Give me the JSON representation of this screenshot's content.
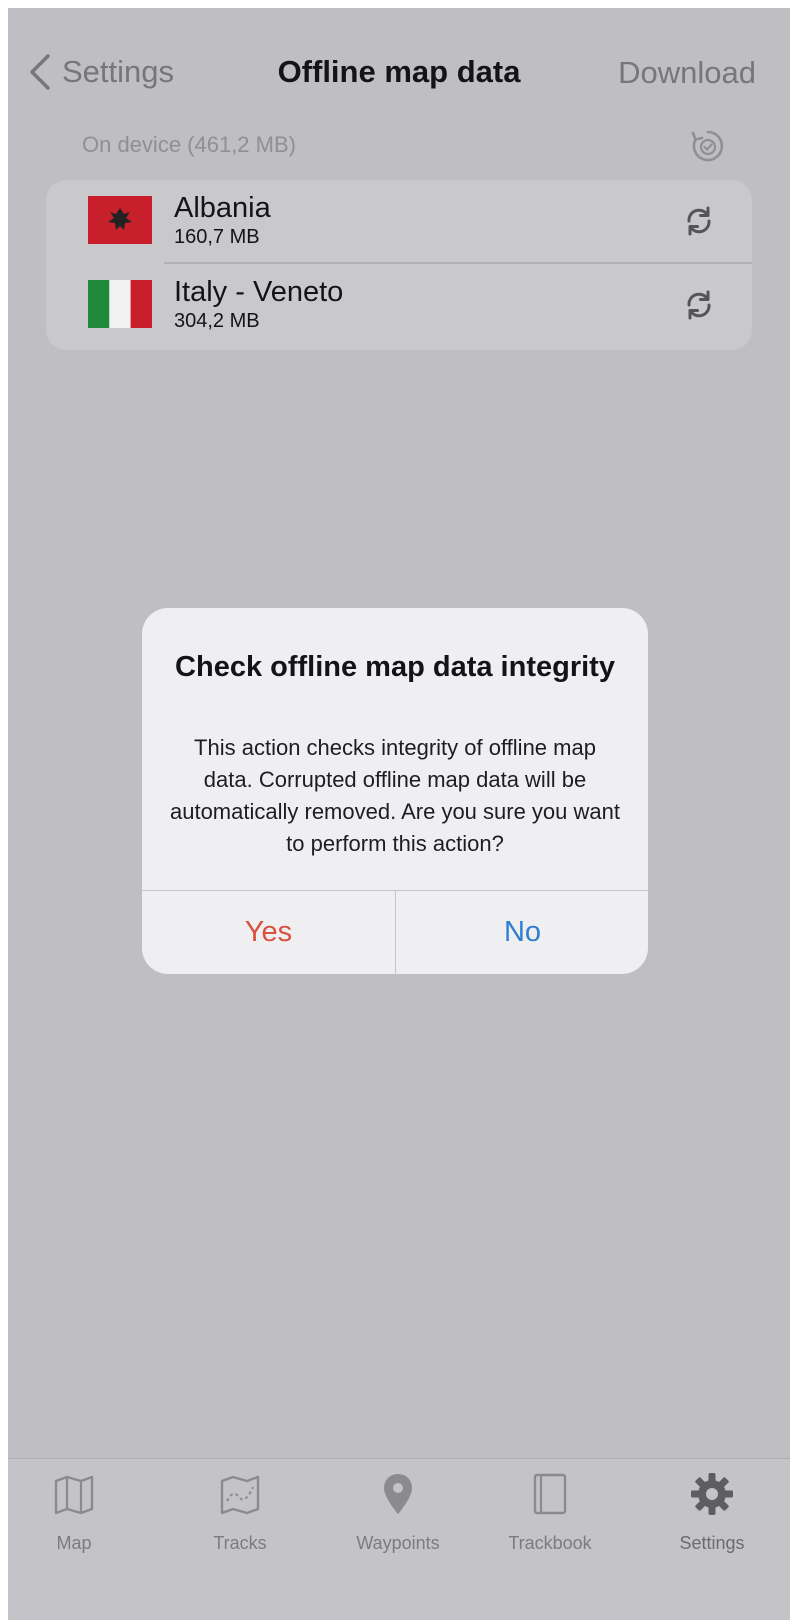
{
  "nav": {
    "back_label": "Settings",
    "title": "Offline map data",
    "download_label": "Download"
  },
  "section": {
    "header": "On device (461,2 MB)"
  },
  "maps": [
    {
      "name": "Albania",
      "size": "160,7 MB",
      "flag": "albania-flag-icon"
    },
    {
      "name": "Italy - Veneto",
      "size": "304,2 MB",
      "flag": "italy-flag-icon"
    }
  ],
  "dialog": {
    "title": "Check offline map data integrity",
    "message": "This action checks integrity of offline map data. Corrupted offline map data will be automatically removed. Are you sure you want to perform this action?",
    "yes_label": "Yes",
    "no_label": "No"
  },
  "tabbar": {
    "tabs": [
      {
        "label": "Map",
        "icon": "map-icon"
      },
      {
        "label": "Tracks",
        "icon": "tracks-icon"
      },
      {
        "label": "Waypoints",
        "icon": "waypoint-pin-icon"
      },
      {
        "label": "Trackbook",
        "icon": "trackbook-icon"
      },
      {
        "label": "Settings",
        "icon": "gear-icon"
      }
    ],
    "selected": "Settings"
  },
  "colors": {
    "background": "#bfbec3",
    "yes": "#d9503e",
    "no": "#2f7fd0",
    "albania_red": "#c8202b",
    "italy_green": "#1f8a3c",
    "italy_red": "#c8202b"
  }
}
